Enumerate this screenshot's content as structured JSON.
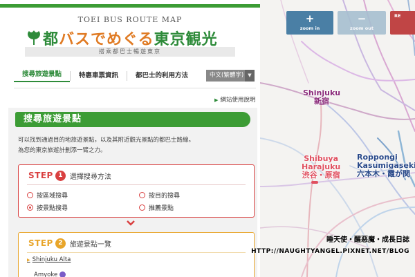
{
  "header": {
    "title_en": "TOEI BUS ROUTE MAP",
    "title_parts": [
      "都",
      "バスでめぐる",
      "東京観光"
    ],
    "subtitle": "搭乘都巴士暢遊東京"
  },
  "nav": {
    "items": [
      "搜尋旅遊景點",
      "特惠車票資訊",
      "都巴士的利用方法"
    ],
    "language": "中文(繁體字)",
    "help_link": "網站使用說明"
  },
  "main": {
    "section_title": "搜尋旅遊景點",
    "intro_line1": "可以找到通過目的地旅遊景點，以及其附近觀光景點的都巴士路線。",
    "intro_line2": "為您的東京旅遊計劃添一臂之力。",
    "step1": {
      "word": "STEP",
      "number": "1",
      "title": "選擇搜尋方法",
      "options": [
        "按區域搜尋",
        "按目的搜尋",
        "按景點搜尋",
        "推薦景點"
      ],
      "selected": "按景點搜尋"
    },
    "step2": {
      "word": "STEP",
      "number": "2",
      "title": "旅遊景點一覽",
      "items": [
        "Shinjuku Alta",
        "Amyoke"
      ]
    }
  },
  "map": {
    "buttons": {
      "zoom_in_symbol": "+",
      "zoom_in": "zoom in",
      "zoom_out_symbol": "−",
      "zoom_out": "zoom out",
      "reset_symbol": "",
      "reset": "RE"
    },
    "stations": {
      "shinjuku_en": "Shinjuku",
      "shinjuku_jp": "新宿",
      "shibuya_en1": "Shibuya",
      "shibuya_en2": "Harajuku",
      "shibuya_jp": "渋谷・原宿",
      "roppongi_en1": "Roppongi",
      "roppongi_en2": "Kasumigaseki",
      "roppongi_jp": "六本木・霞が関"
    }
  },
  "watermark": {
    "line1": "睡天使・醒惡魔・成長日誌",
    "line2": "HTTP://NAUGHTYANGEL.PIXNET.NET/BLOG"
  },
  "colors": {
    "brand_green": "#3c9c35",
    "step1_red": "#d94040",
    "step2_orange": "#e8a52a",
    "zoom_blue": "#4a7fa5",
    "reset_red": "#c04545"
  }
}
